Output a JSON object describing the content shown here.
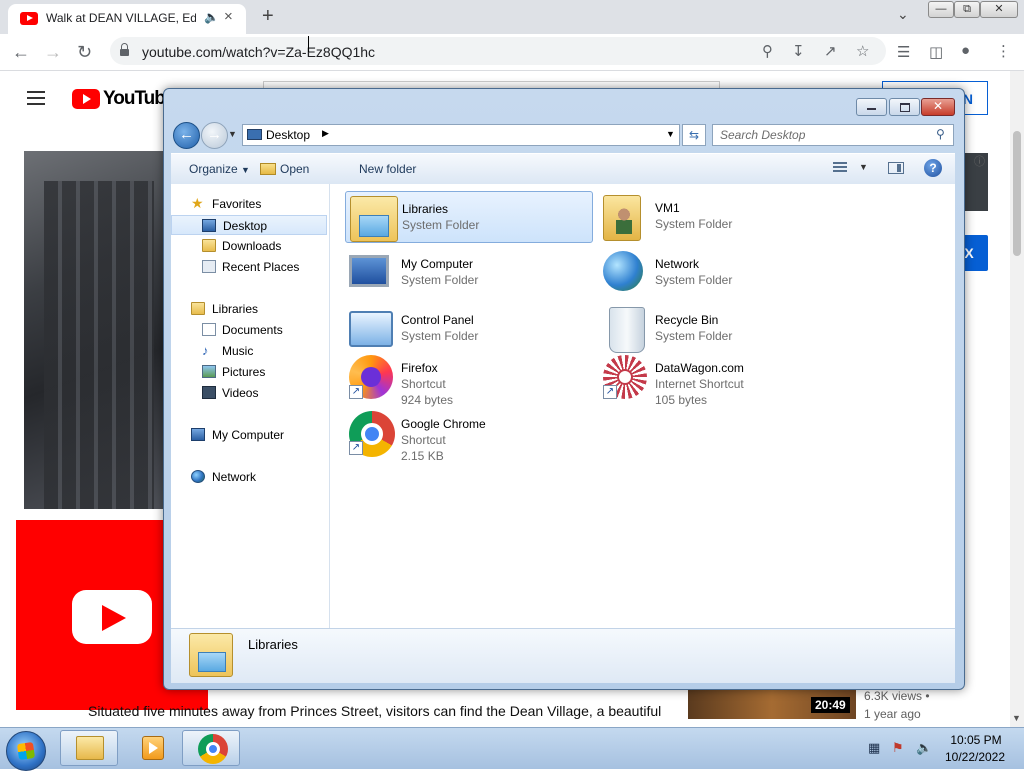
{
  "browser": {
    "tab_title": "Walk at DEAN VILLAGE, Edin",
    "url": "youtube.com/watch?v=Za-Ez8QQ1hc"
  },
  "youtube": {
    "logo_text": "YouTube",
    "signin_label": "IN",
    "blue_button_label": "X",
    "description": "Situated five minutes away from Princes Street, visitors can find the Dean Village, a beautiful",
    "related_duration": "20:49",
    "related_views": "6.3K views •",
    "related_age": "1 year ago",
    "brand_color": "#ff0000"
  },
  "explorer": {
    "address_location": "Desktop",
    "search_placeholder": "Search Desktop",
    "commands": {
      "organize": "Organize",
      "open": "Open",
      "new_folder": "New folder"
    },
    "nav": {
      "favorites": "Favorites",
      "desktop": "Desktop",
      "downloads": "Downloads",
      "recent_places": "Recent Places",
      "libraries": "Libraries",
      "documents": "Documents",
      "music": "Music",
      "pictures": "Pictures",
      "videos": "Videos",
      "my_computer": "My Computer",
      "network": "Network"
    },
    "items": [
      {
        "name": "Libraries",
        "sub1": "System Folder",
        "sub2": ""
      },
      {
        "name": "VM1",
        "sub1": "System Folder",
        "sub2": ""
      },
      {
        "name": "My Computer",
        "sub1": "System Folder",
        "sub2": ""
      },
      {
        "name": "Network",
        "sub1": "System Folder",
        "sub2": ""
      },
      {
        "name": "Control Panel",
        "sub1": "System Folder",
        "sub2": ""
      },
      {
        "name": "Recycle Bin",
        "sub1": "System Folder",
        "sub2": ""
      },
      {
        "name": "Firefox",
        "sub1": "Shortcut",
        "sub2": "924 bytes"
      },
      {
        "name": "DataWagon.com",
        "sub1": "Internet Shortcut",
        "sub2": "105 bytes"
      },
      {
        "name": "Google Chrome",
        "sub1": "Shortcut",
        "sub2": "2.15 KB"
      }
    ],
    "details_name": "Libraries"
  },
  "taskbar": {
    "time": "10:05 PM",
    "date": "10/22/2022"
  }
}
